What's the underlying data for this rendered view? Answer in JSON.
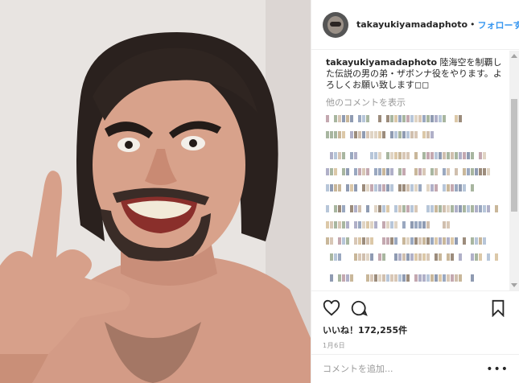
{
  "header": {
    "username": "takayukiyamadaphoto",
    "separator": "•",
    "follow_label": "フォローする"
  },
  "caption": {
    "username": "takayukiyamadaphoto",
    "text": "陸海空を制覇した伝説の男の弟・ザボンナ役をやります。よろしくお願い致します◻◻"
  },
  "comments": {
    "more_label": "他のコメントを表示"
  },
  "actions": {
    "likes_text": "いいね！172,255件",
    "date_text": "1月6日"
  },
  "add_comment": {
    "placeholder": "コメントを追加...",
    "more_icon": "•••"
  },
  "icons": {
    "like": "heart-icon",
    "comment": "comment-icon",
    "save": "bookmark-icon"
  }
}
